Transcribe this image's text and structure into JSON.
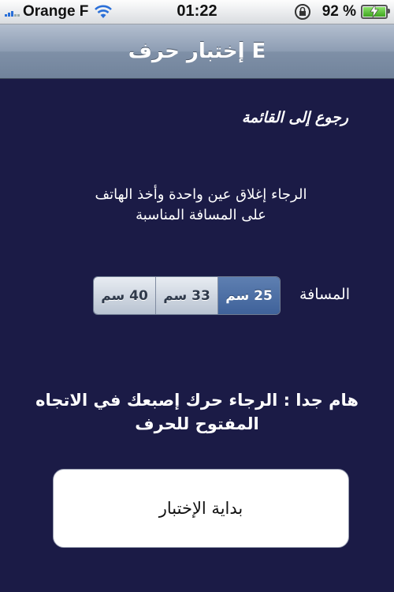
{
  "status_bar": {
    "carrier": "Orange F",
    "time": "01:22",
    "battery_percent": "92 %",
    "battery_level": 0.92,
    "icons": [
      "signal-icon",
      "wifi-icon",
      "rotation-lock-icon",
      "battery-charging-icon"
    ]
  },
  "nav": {
    "title": "إختبار حرف E"
  },
  "back_link": "رجوع إلى القائمة",
  "instruction": {
    "line1": "الرجاء إغلاق عين واحدة وأخذ الهاتف",
    "line2": "على المسافة المناسبة"
  },
  "distance": {
    "label": "المسافة",
    "options": [
      "40 سم",
      "33 سم",
      "25 سم"
    ],
    "selected": "25 سم"
  },
  "important": {
    "line1": "هام جدا : الرجاء حرك إصبعك في الاتجاه",
    "line2": "المفتوح للحرف"
  },
  "start_button": "بداية الإختبار",
  "colors": {
    "background": "#1b1b46",
    "navbar": "#8d9db3",
    "segment_selected": "#4a6ba3"
  }
}
